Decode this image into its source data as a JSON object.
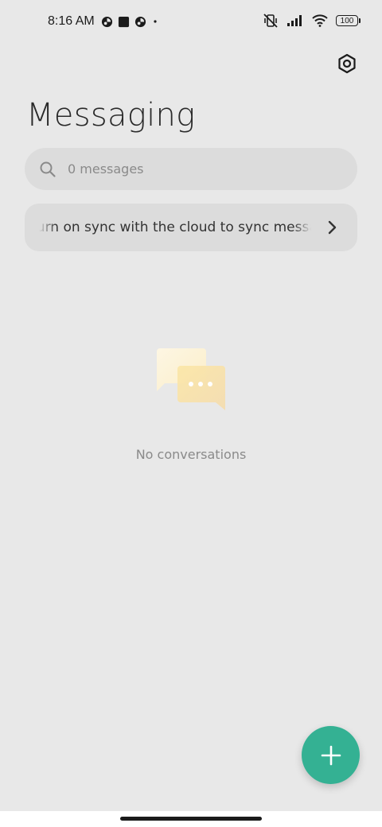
{
  "status_bar": {
    "time": "8:16 AM",
    "battery": "100",
    "left_icons": [
      "notification-app-icon",
      "square-app-icon",
      "notification-app-icon",
      "dot-icon"
    ],
    "right_icons": [
      "muted-vibrate-icon",
      "signal-icon",
      "wifi-icon",
      "battery-icon"
    ]
  },
  "header": {
    "title": "Messaging",
    "settings_icon": "settings-hexagon-icon"
  },
  "search": {
    "placeholder": "0 messages",
    "icon": "search-icon"
  },
  "sync_banner": {
    "text": "Turn on sync with the cloud to sync messages",
    "icon": "chevron-right-icon"
  },
  "empty_state": {
    "icon": "chat-bubbles-icon",
    "text": "No conversations"
  },
  "fab": {
    "icon": "plus-icon",
    "color": "#34b193"
  },
  "colors": {
    "background": "#e8e8e8",
    "surface": "#dcdcdc",
    "accent": "#34b193"
  }
}
